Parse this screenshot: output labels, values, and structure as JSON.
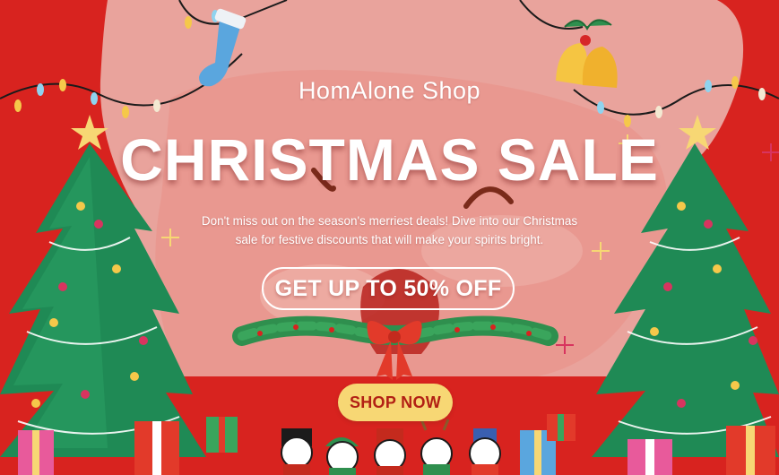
{
  "banner": {
    "shop_name": "HomAlone Shop",
    "headline": "CHRISTMAS SALE",
    "tagline_line1": "Don't miss out on the season's merriest deals! Dive into our Christmas",
    "tagline_line2": "sale for festive discounts that will make your spirits bright.",
    "offer_label": "GET UP TO 50% OFF",
    "cta_label": "SHOP NOW"
  },
  "colors": {
    "background_red": "#d8231f",
    "pink_panel": "#e9a39c",
    "tree_green": "#1f8a55",
    "cta_yellow": "#f7d774",
    "cta_text": "#b22014",
    "bow_red": "#e23a2a"
  },
  "decorations": {
    "left_tree": "christmas-tree",
    "right_tree": "christmas-tree",
    "garland": "holly-garland-with-bow",
    "lights": "string-lights",
    "bells": "jingle-bells",
    "stocking": "christmas-stocking",
    "characters": "panda-characters",
    "gifts": "gift-boxes"
  }
}
